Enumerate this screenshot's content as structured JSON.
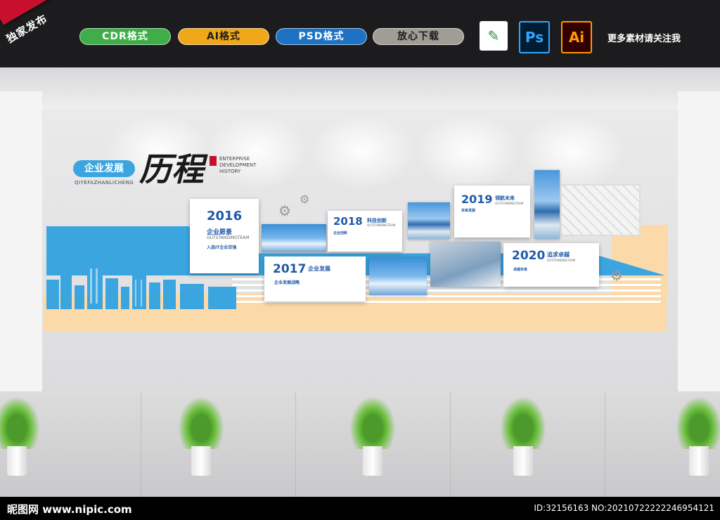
{
  "banner": {
    "ribbon": "独家发布",
    "badges": [
      "CDR格式",
      "AI格式",
      "PSD格式",
      "放心下载"
    ],
    "app_icons": {
      "ps": "Ps",
      "ai": "Ai",
      "cdr": "cdr-icon"
    },
    "follow": "更多素材请关注我"
  },
  "wall_title": {
    "badge": "企业发展",
    "pinyin": "QIYEFAZHANLICHENG",
    "big": "历程",
    "english": "ENTERPRISE DEVELOPMENT HISTORY"
  },
  "timeline": [
    {
      "year": "2016",
      "title": "企业愿景",
      "sub": "OUTSTANDINGTEAM",
      "headline": "入选IT企业百强"
    },
    {
      "year": "2017",
      "title": "企业发展",
      "sub": "企业发展战略"
    },
    {
      "year": "2018",
      "title": "科技创新",
      "sub": "OUTSTANDINGTEAM",
      "headline": "企业创新"
    },
    {
      "year": "2019",
      "title": "领航未来",
      "sub": "OUTSTANDINGTEAM",
      "headline": "未来发展"
    },
    {
      "year": "2020",
      "title": "追求卓越",
      "sub": "OUTSTANDINGTEAM",
      "headline": "卓越未来"
    }
  ],
  "footer": {
    "site": "昵图网 www.nipic.com",
    "id": "ID:32156163 NO:20210722222246954121"
  },
  "colors": {
    "accent_blue": "#3ba5e0",
    "year_blue": "#1e5aa8",
    "beige": "#fbd9a8"
  }
}
